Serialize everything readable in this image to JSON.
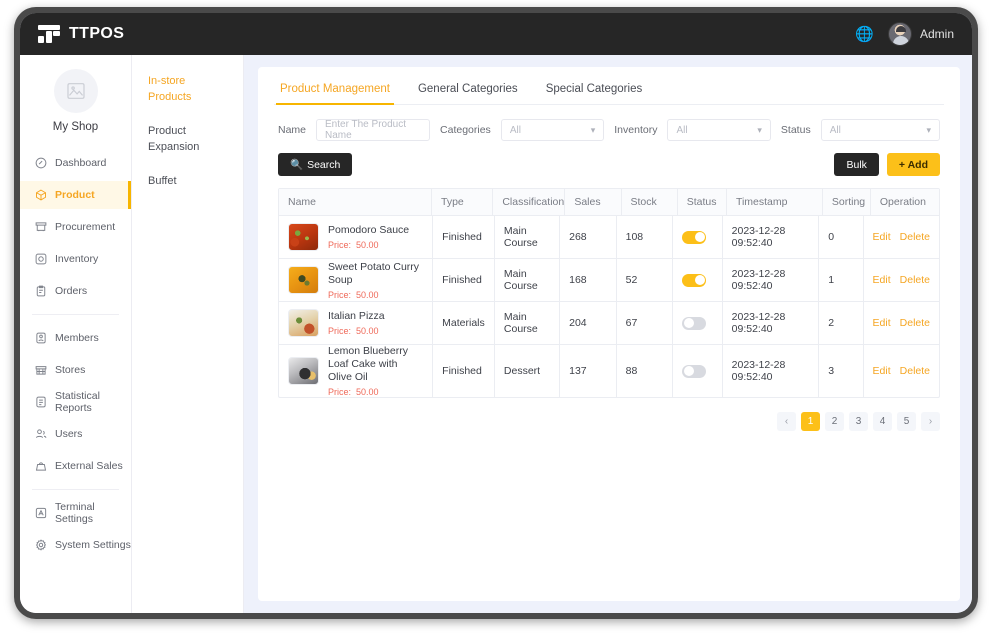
{
  "topbar": {
    "brand": "TTPOS",
    "logo_icon": "ttpos-logo-icon",
    "globe_icon": "globe-icon",
    "user_name": "Admin",
    "avatar_icon": "user-avatar"
  },
  "sidebar": {
    "shop_name": "My Shop",
    "shop_avatar_icon": "shop-image-placeholder-icon",
    "items": [
      {
        "label": "Dashboard",
        "icon": "dashboard-icon",
        "active": false
      },
      {
        "label": "Product",
        "icon": "product-cube-icon",
        "active": true
      },
      {
        "label": "Procurement",
        "icon": "procurement-cart-icon",
        "active": false
      },
      {
        "label": "Inventory",
        "icon": "inventory-box-icon",
        "active": false
      },
      {
        "label": "Orders",
        "icon": "orders-clipboard-icon",
        "active": false
      }
    ],
    "items2": [
      {
        "label": "Members",
        "icon": "members-user-icon",
        "active": false
      },
      {
        "label": "Stores",
        "icon": "stores-building-icon",
        "active": false
      },
      {
        "label": "Statistical Reports",
        "icon": "reports-document-icon",
        "active": false
      },
      {
        "label": "Users",
        "icon": "users-group-icon",
        "active": false
      },
      {
        "label": "External Sales",
        "icon": "external-sales-bag-icon",
        "active": false
      }
    ],
    "items3": [
      {
        "label": "Terminal Settings",
        "icon": "terminal-settings-icon",
        "active": false
      },
      {
        "label": "System Settings",
        "icon": "system-settings-gear-icon",
        "active": false
      }
    ]
  },
  "subnav": {
    "items": [
      {
        "label": "In-store Products",
        "active": true
      },
      {
        "label": "Product Expansion",
        "active": false
      },
      {
        "label": "Buffet",
        "active": false
      }
    ]
  },
  "tabs": [
    {
      "label": "Product Management",
      "active": true
    },
    {
      "label": "General Categories",
      "active": false
    },
    {
      "label": "Special Categories",
      "active": false
    }
  ],
  "filters": {
    "name_label": "Name",
    "name_placeholder": "Enter The Product Name",
    "name_value": "",
    "categories_label": "Categories",
    "categories_value": "All",
    "inventory_label": "Inventory",
    "inventory_value": "All",
    "status_label": "Status",
    "status_value": "All",
    "caret_icon": "chevron-down-icon"
  },
  "actions": {
    "search_label": "Search",
    "search_icon": "search-icon",
    "bulk_label": "Bulk",
    "add_label": "+ Add"
  },
  "table": {
    "columns": [
      "Name",
      "Type",
      "Classification",
      "Sales",
      "Stock",
      "Status",
      "Timestamp",
      "Sorting",
      "Operation"
    ],
    "price_label": "Price:",
    "rows": [
      {
        "name": "Pomodoro Sauce",
        "price": "50.00",
        "thumb": "th-pomodoro",
        "type": "Finished",
        "classification": "Main Course",
        "sales": "268",
        "stock": "108",
        "status_on": true,
        "timestamp": "2023-12-28 09:52:40",
        "sorting": "0",
        "edit": "Edit",
        "delete": "Delete"
      },
      {
        "name": "Sweet Potato Curry Soup",
        "price": "50.00",
        "thumb": "th-curry",
        "type": "Finished",
        "classification": "Main Course",
        "sales": "168",
        "stock": "52",
        "status_on": true,
        "timestamp": "2023-12-28 09:52:40",
        "sorting": "1",
        "edit": "Edit",
        "delete": "Delete"
      },
      {
        "name": "Italian Pizza",
        "price": "50.00",
        "thumb": "th-pizza",
        "type": "Materials",
        "classification": "Main Course",
        "sales": "204",
        "stock": "67",
        "status_on": false,
        "timestamp": "2023-12-28 09:52:40",
        "sorting": "2",
        "edit": "Edit",
        "delete": "Delete"
      },
      {
        "name": "Lemon Blueberry Loaf Cake with Olive Oil",
        "price": "50.00",
        "thumb": "th-lemon",
        "type": "Finished",
        "classification": "Dessert",
        "sales": "137",
        "stock": "88",
        "status_on": false,
        "timestamp": "2023-12-28 09:52:40",
        "sorting": "3",
        "edit": "Edit",
        "delete": "Delete"
      }
    ]
  },
  "pagination": {
    "prev_icon": "chevron-left-icon",
    "next_icon": "chevron-right-icon",
    "pages": [
      "1",
      "2",
      "3",
      "4",
      "5"
    ],
    "current": "1"
  },
  "colors": {
    "accent": "#f5a623",
    "accent_button": "#fcc019",
    "dark": "#262626",
    "price": "#ef6a5a",
    "page_bg": "#eef1fb"
  }
}
